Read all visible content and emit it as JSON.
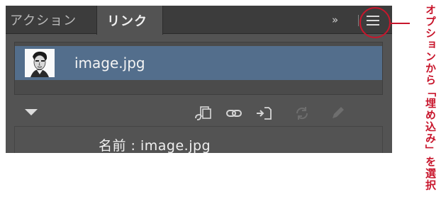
{
  "tabs": [
    {
      "label": "アクション",
      "active": false
    },
    {
      "label": "リンク",
      "active": true
    }
  ],
  "panel_controls": {
    "collapse_label": "»",
    "collapse_icon": "double-chevron-right-icon",
    "menu_icon": "hamburger-menu-icon"
  },
  "links": [
    {
      "name": "image.jpg",
      "thumbnail_icon": "portrait-thumbnail",
      "selected": true
    }
  ],
  "toolbar_icons": [
    {
      "name": "relink-from-library-icon",
      "enabled": true
    },
    {
      "name": "relink-icon",
      "enabled": true
    },
    {
      "name": "go-to-link-icon",
      "enabled": true
    },
    {
      "name": "update-link-icon",
      "enabled": false
    },
    {
      "name": "edit-original-icon",
      "enabled": false
    }
  ],
  "info": {
    "label": "名前 : image.jpg"
  },
  "annotation": {
    "text": "オプションから「埋め込み」を選択",
    "color": "#c8162c"
  },
  "colors": {
    "panel_bg": "#535353",
    "tabbar_bg": "#3c3c3c",
    "selection": "#536e8c",
    "annotation_red": "#c8162c"
  }
}
